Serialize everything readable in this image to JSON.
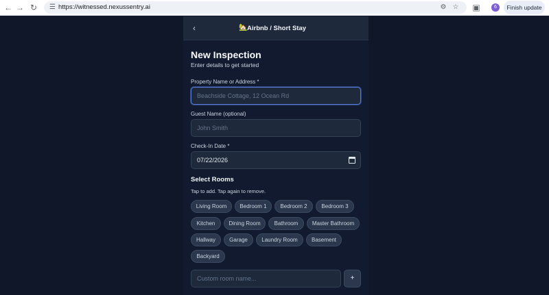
{
  "browser": {
    "url": "https://witnessed.nexussentry.ai",
    "profile_initial": "6",
    "finish_update_label": "Finish update"
  },
  "header": {
    "title": "Airbnb / Short Stay",
    "icon": "house-icon"
  },
  "form": {
    "title": "New Inspection",
    "subtitle": "Enter details to get started",
    "property": {
      "label": "Property Name or Address *",
      "placeholder": "Beachside Cottage, 12 Ocean Rd"
    },
    "guest": {
      "label": "Guest Name (optional)",
      "placeholder": "John Smith"
    },
    "checkin": {
      "label": "Check-In Date *",
      "value": "07/22/2026"
    },
    "rooms": {
      "title": "Select Rooms",
      "hint": "Tap to add. Tap again to remove.",
      "chips": [
        "Living Room",
        "Bedroom 1",
        "Bedroom 2",
        "Bedroom 3",
        "Kitchen",
        "Dining Room",
        "Bathroom",
        "Master Bathroom",
        "Hallway",
        "Garage",
        "Laundry Room",
        "Basement",
        "Backyard"
      ]
    },
    "custom_room": {
      "placeholder": "Custom room name...",
      "add_label": "+"
    }
  }
}
